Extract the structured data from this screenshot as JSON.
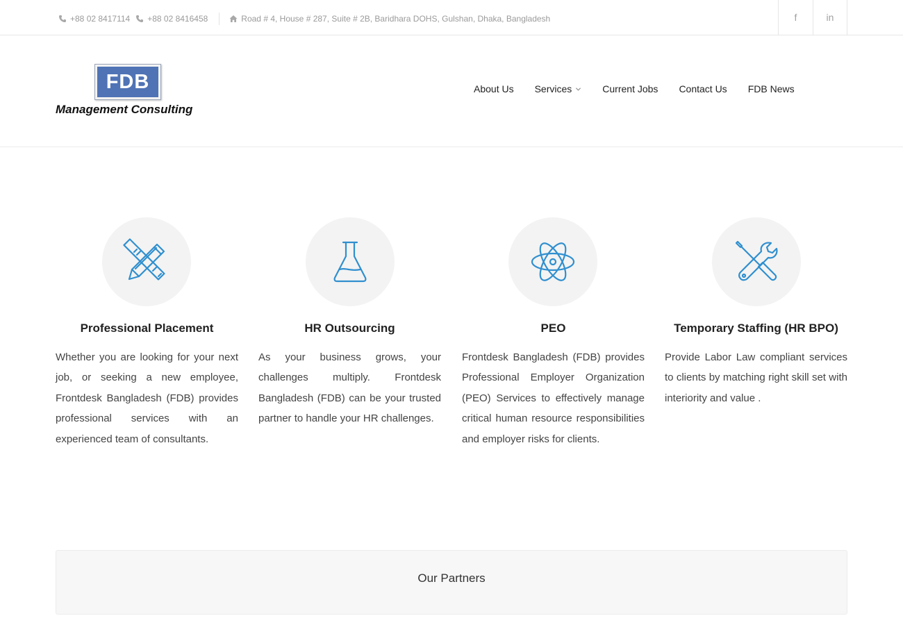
{
  "topbar": {
    "phone1": "+88 02 8417114",
    "phone2": "+88 02 8416458",
    "address": "Road # 4, House # 287, Suite # 2B, Baridhara DOHS, Gulshan, Dhaka, Bangladesh",
    "social": [
      {
        "name": "facebook-icon",
        "glyph": "f"
      },
      {
        "name": "linkedin-icon",
        "glyph": "in"
      }
    ]
  },
  "logo": {
    "mark": "FDB",
    "tagline": "Management Consulting"
  },
  "nav": {
    "items": [
      "About Us",
      "Services",
      "Current Jobs",
      "Contact Us",
      "FDB News"
    ]
  },
  "services": [
    {
      "icon": "pencil-ruler-icon",
      "title": "Professional Placement",
      "text": "Whether you are looking for your next job, or seeking a new employee, Frontdesk Bangladesh (FDB) provides professional services with an experienced team of consultants."
    },
    {
      "icon": "flask-icon",
      "title": "HR Outsourcing",
      "text": "As your business grows, your challenges multiply. Frontdesk Bangladesh (FDB) can be your trusted partner to handle your HR challenges."
    },
    {
      "icon": "atom-icon",
      "title": "PEO",
      "text": "Frontdesk Bangladesh (FDB) provides Professional Employer Organization (PEO) Services to effectively manage critical human resource responsibilities and employer risks for clients."
    },
    {
      "icon": "tools-icon",
      "title": "Temporary Staffing (HR BPO)",
      "text": "Provide Labor Law compliant services to clients by matching right skill set with interiority and value ."
    }
  ],
  "partners": {
    "title": "Our Partners"
  },
  "colors": {
    "icon_blue": "#2f8fcf",
    "logo_blue": "#4f73b5",
    "circle_bg": "#f3f3f3"
  }
}
